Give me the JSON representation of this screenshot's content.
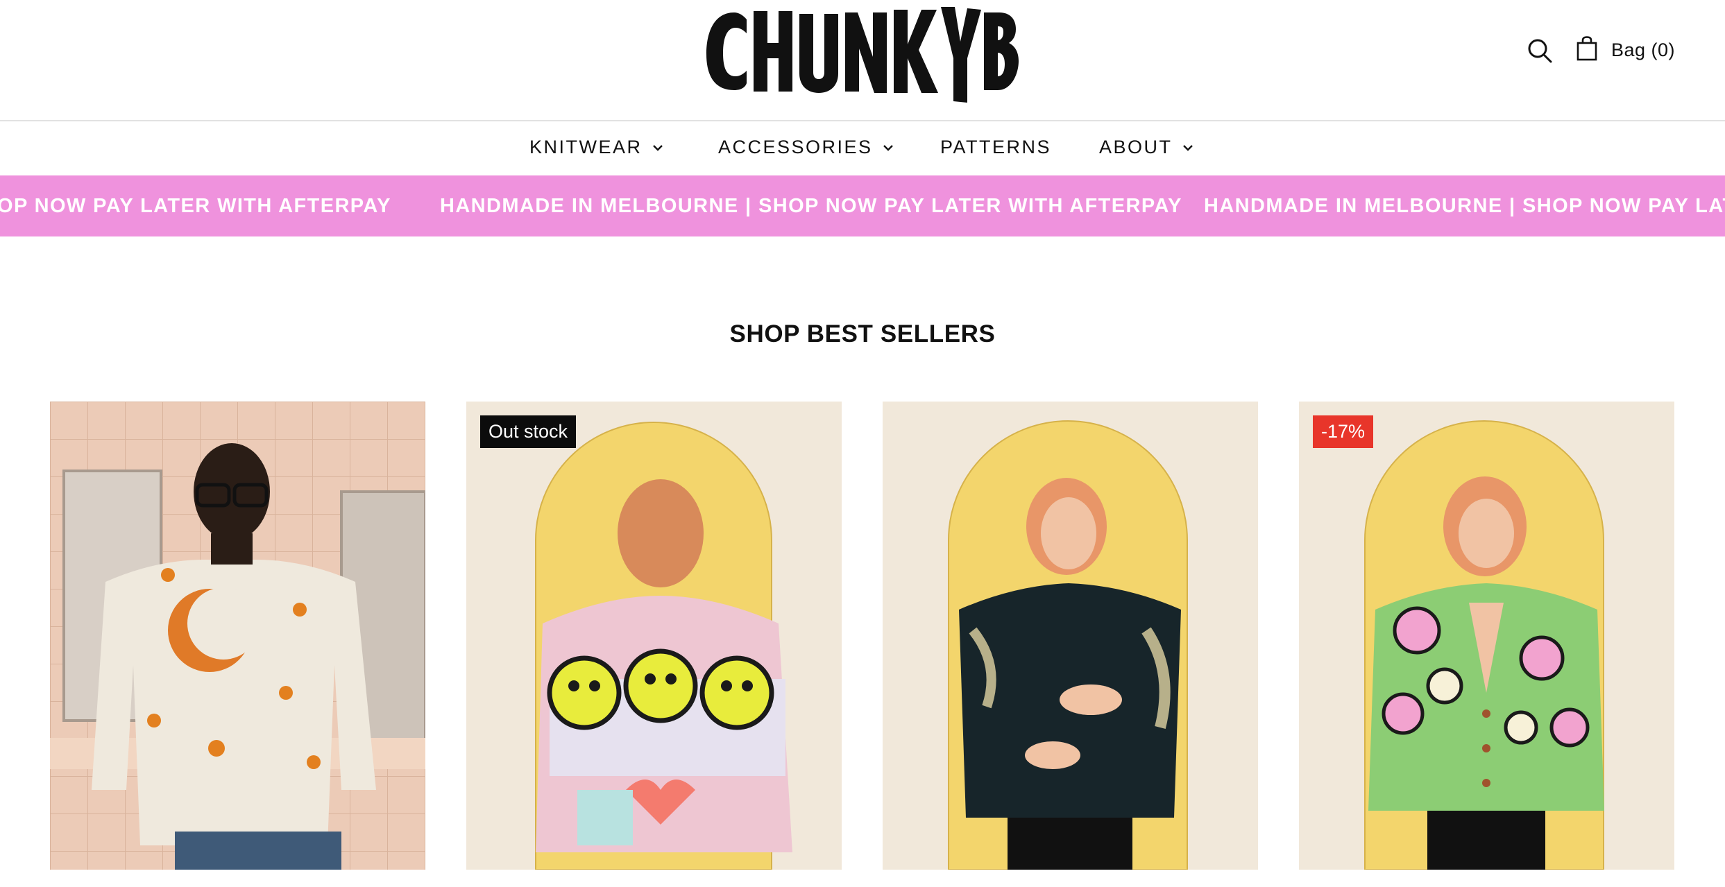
{
  "header": {
    "logo_text": "CHUNKYBOY",
    "search_icon": "search-icon",
    "bag_icon": "shopping-bag-icon",
    "bag_label": "Bag (0)"
  },
  "nav": {
    "items": [
      {
        "label": "KNITWEAR",
        "has_dropdown": true
      },
      {
        "label": "ACCESSORIES",
        "has_dropdown": true
      },
      {
        "label": "PATTERNS",
        "has_dropdown": false
      },
      {
        "label": "ABOUT",
        "has_dropdown": true
      }
    ]
  },
  "marquee": {
    "segments": [
      "OP NOW PAY LATER WITH AFTERPAY",
      "HANDMADE IN MELBOURNE | SHOP NOW PAY LATER WITH AFTERPAY",
      "HANDMADE IN MELBOURNE | SHOP NOW PAY LATE"
    ],
    "background": "#ef92dd",
    "text_color": "#ffffff"
  },
  "section": {
    "title": "SHOP BEST SELLERS"
  },
  "products": [
    {
      "badge": ""
    },
    {
      "badge": "Out stock"
    },
    {
      "badge": ""
    },
    {
      "badge": "-17%"
    }
  ],
  "colors": {
    "badge_dark": "#0c0c0c",
    "badge_sale": "#e8352a",
    "accent_pink": "#ef92dd"
  }
}
